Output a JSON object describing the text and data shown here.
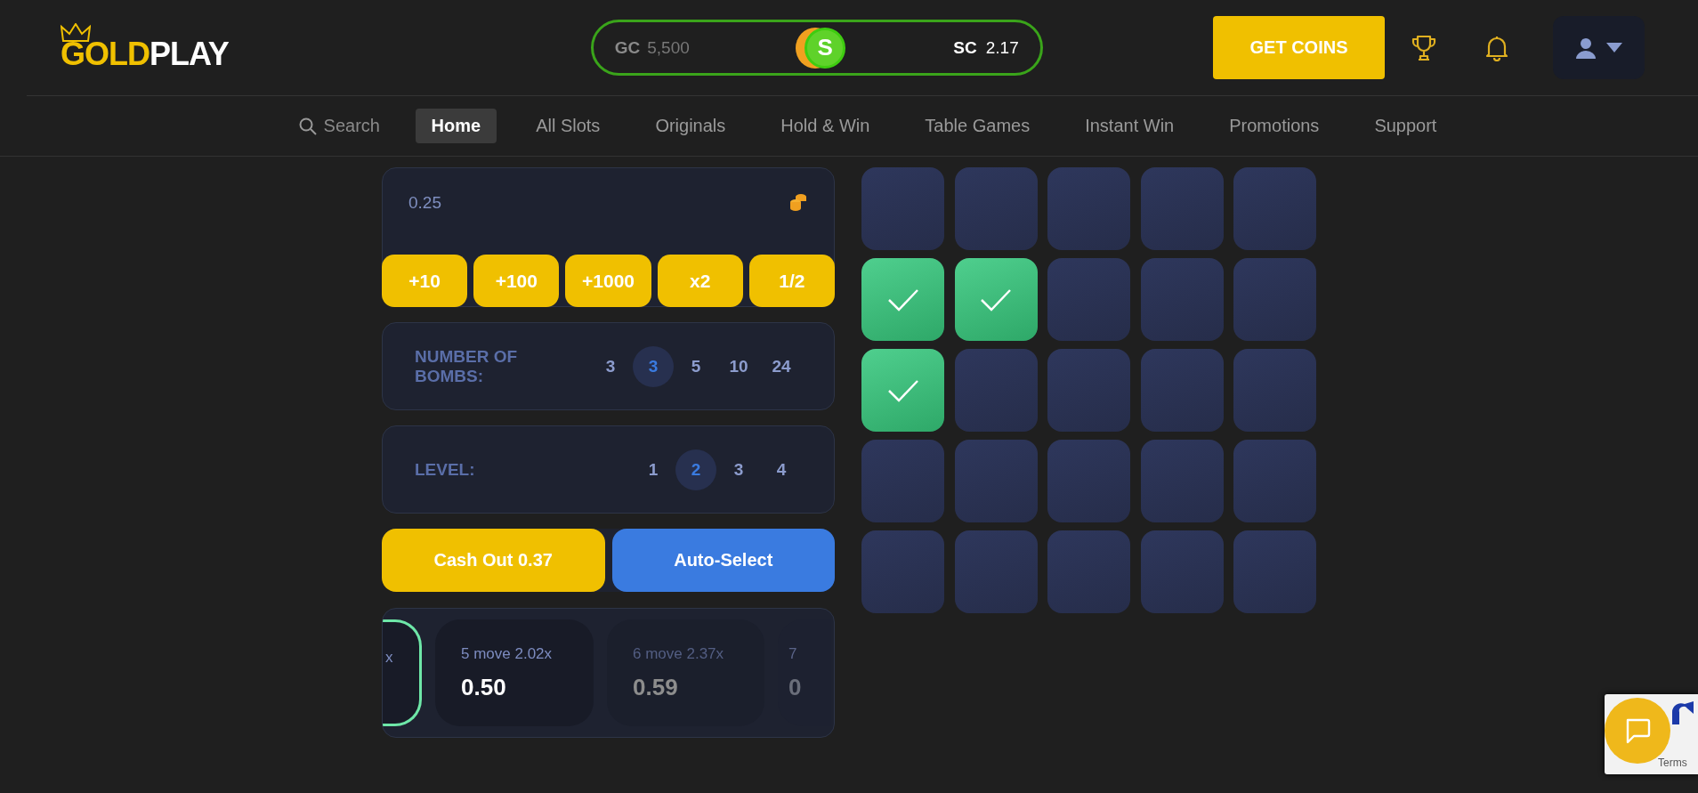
{
  "logo": {
    "parts": [
      "GOLD",
      "PLAY"
    ]
  },
  "balance": {
    "gc_label": "GC",
    "gc_value": "5,500",
    "coin_symbol": "S",
    "sc_label": "SC",
    "sc_value": "2.17"
  },
  "get_coins": "GET COINS",
  "nav": {
    "search": {
      "placeholder": "Search"
    },
    "items": [
      {
        "label": "Home",
        "selected": true
      },
      {
        "label": "All Slots",
        "selected": false
      },
      {
        "label": "Originals",
        "selected": false
      },
      {
        "label": "Hold & Win",
        "selected": false
      },
      {
        "label": "Table Games",
        "selected": false
      },
      {
        "label": "Instant Win",
        "selected": false
      },
      {
        "label": "Promotions",
        "selected": false
      },
      {
        "label": "Support",
        "selected": false
      }
    ]
  },
  "bet": {
    "value": "0.25",
    "buttons": [
      "+10",
      "+100",
      "+1000",
      "x2",
      "1/2"
    ]
  },
  "bombs": {
    "label": "NUMBER OF BOMBS:",
    "options": [
      {
        "label": "3",
        "selected": false
      },
      {
        "label": "3",
        "selected": true
      },
      {
        "label": "5",
        "selected": false
      },
      {
        "label": "10",
        "selected": false
      },
      {
        "label": "24",
        "selected": false
      }
    ]
  },
  "level": {
    "label": "LEVEL:",
    "options": [
      {
        "label": "1",
        "selected": false
      },
      {
        "label": "2",
        "selected": true
      },
      {
        "label": "3",
        "selected": false
      },
      {
        "label": "4",
        "selected": false
      }
    ]
  },
  "actions": [
    {
      "kind": "cashout",
      "label": "Cash Out 0.37"
    },
    {
      "kind": "auto",
      "label": "Auto-Select"
    }
  ],
  "moves": [
    {
      "kind": "done",
      "title": "x"
    },
    {
      "kind": "current",
      "title": "5 move 2.02x",
      "amount": "0.50"
    },
    {
      "kind": "next",
      "title": "6 move 2.37x",
      "amount": "0.59"
    },
    {
      "kind": "far",
      "title": "7",
      "amount": "0"
    }
  ],
  "tiles": [
    {
      "revealed": false
    },
    {
      "revealed": false
    },
    {
      "revealed": false
    },
    {
      "revealed": false
    },
    {
      "revealed": false
    },
    {
      "revealed": true
    },
    {
      "revealed": true
    },
    {
      "revealed": false
    },
    {
      "revealed": false
    },
    {
      "revealed": false
    },
    {
      "revealed": true
    },
    {
      "revealed": false
    },
    {
      "revealed": false
    },
    {
      "revealed": false
    },
    {
      "revealed": false
    },
    {
      "revealed": false
    },
    {
      "revealed": false
    },
    {
      "revealed": false
    },
    {
      "revealed": false
    },
    {
      "revealed": false
    },
    {
      "revealed": false
    },
    {
      "revealed": false
    },
    {
      "revealed": false
    },
    {
      "revealed": false
    },
    {
      "revealed": false
    }
  ],
  "recaptcha": {
    "text": "Terms"
  }
}
